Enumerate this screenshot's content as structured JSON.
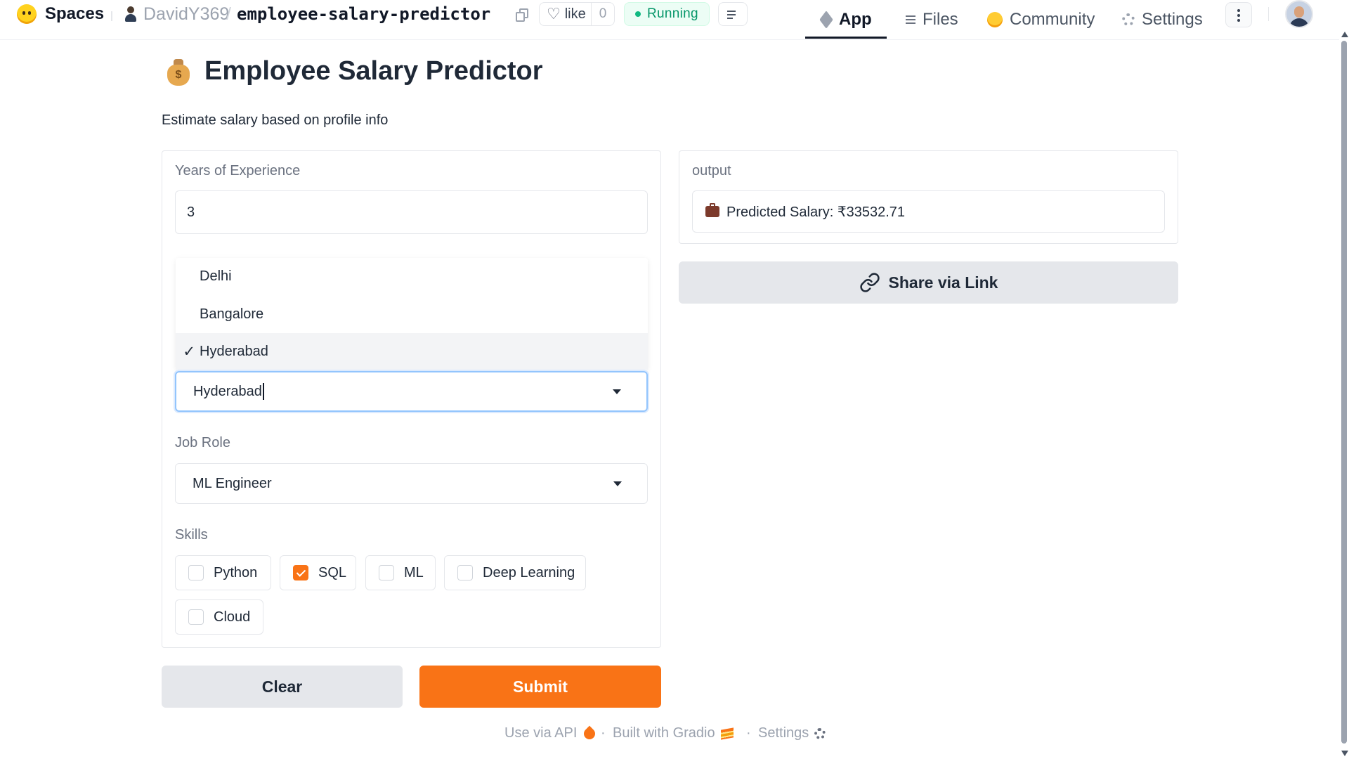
{
  "topbar": {
    "spaces_label": "Spaces",
    "owner": "DavidY369",
    "separator": "/",
    "repo": "employee-salary-predictor",
    "like_label": "like",
    "like_count": "0",
    "status": "Running",
    "status_color": "#10b981",
    "tabs": [
      {
        "label": "App",
        "icon": "cube-icon",
        "active": true
      },
      {
        "label": "Files",
        "icon": "files-icon"
      },
      {
        "label": "Community",
        "icon": "hugging-face-icon"
      },
      {
        "label": "Settings",
        "icon": "gear-icon"
      }
    ]
  },
  "app": {
    "title": "Employee Salary Predictor",
    "title_icon": "money-bag-icon",
    "description": "Estimate salary based on profile info",
    "experience": {
      "label": "Years of Experience",
      "value": "3"
    },
    "city": {
      "options": [
        "Delhi",
        "Bangalore",
        "Hyderabad"
      ],
      "selected_mark": "✓",
      "value": "Hyderabad"
    },
    "job_role": {
      "label": "Job Role",
      "value": "ML Engineer"
    },
    "skills": {
      "label": "Skills",
      "items": [
        {
          "label": "Python",
          "checked": false
        },
        {
          "label": "SQL",
          "checked": true
        },
        {
          "label": "ML",
          "checked": false
        },
        {
          "label": "Deep Learning",
          "checked": false
        },
        {
          "label": "Cloud",
          "checked": false
        }
      ]
    },
    "clear_label": "Clear",
    "submit_label": "Submit",
    "accent_color": "#f97316",
    "output": {
      "label": "output",
      "icon": "briefcase-icon",
      "value": "Predicted Salary: ₹33532.71"
    },
    "share_label": "Share via Link"
  },
  "footer": {
    "api_label": "Use via API",
    "built_label": "Built with Gradio",
    "settings_label": "Settings",
    "dot": "·"
  }
}
